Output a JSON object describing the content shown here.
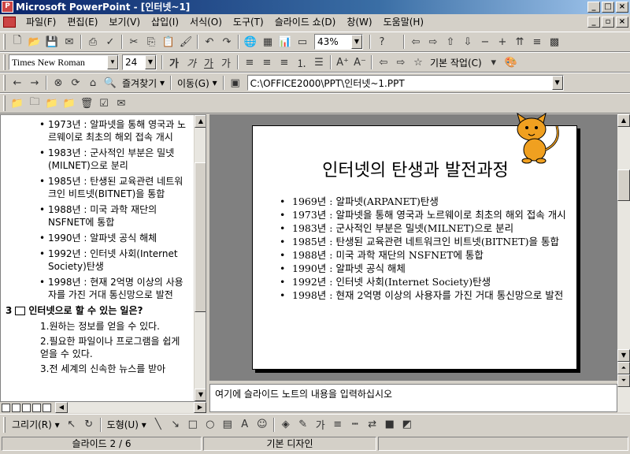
{
  "window": {
    "title": "Microsoft PowerPoint - [인터넷~1]"
  },
  "menu": [
    "파일(F)",
    "편집(E)",
    "보기(V)",
    "삽입(I)",
    "서식(O)",
    "도구(T)",
    "슬라이드 쇼(D)",
    "창(W)",
    "도움말(H)"
  ],
  "standard_toolbar": {
    "zoom": "43%"
  },
  "formatting_toolbar": {
    "font": "Times New Roman",
    "size": "24",
    "design_label": "기본 작업(C)",
    "format_glyphs": [
      "가",
      "가",
      "가",
      "가"
    ]
  },
  "web_toolbar": {
    "favorites": "즐겨찾기",
    "go": "이동(G)",
    "address": "C:\\OFFICE2000\\PPT\\인터넷~1.PPT"
  },
  "outline": {
    "bullets": [
      "1973년 : 알파넷을 통해 영국과 노르웨이로 최초의 해외 접속 개시",
      "1983년 : 군사적인 부분은 밀넷(MILNET)으로 분리",
      "1985년 : 탄생된 교육관련 네트워크인 비트넷(BITNET)을 통합",
      "1988년 : 미국 과학 재단의 NSFNET에 통합",
      "1990년 : 알파넷 공식 해체",
      "1992년 : 인터넷 사회(Internet Society)탄생",
      "1998년 : 현재 2억명 이상의 사용자를 가진 거대 통신망으로 발전"
    ],
    "slide3": {
      "num": "3",
      "title": "인터넷으로 할 수 있는 일은?"
    },
    "slide3_items": [
      "1.원하는 정보를 얻을 수 있다.",
      "2.필요한 파일이나 프로그램을 쉽게 얻을 수 있다.",
      "3.전 세계의 신속한 뉴스를 받아"
    ]
  },
  "slide": {
    "title": "인터넷의 탄생과 발전과정",
    "bullets": [
      "1969년 : 알파넷(ARPANET)탄생",
      "1973년 : 알파넷을 통해 영국과 노르웨이로 최초의 해외 접속 개시",
      "1983년 : 군사적인 부분은 밀넷(MILNET)으로 분리",
      "1985년 : 탄생된 교육관련 네트워크인 비트넷(BITNET)을 통합",
      "1988년 : 미국 과학 재단의 NSFNET에 통합",
      "1990년 : 알파넷 공식 해체",
      "1992년 : 인터넷 사회(Internet Society)탄생",
      "1998년 : 현재 2억명 이상의 사용자를 가진 거대 통신망으로 발전"
    ]
  },
  "notes": {
    "placeholder": "여기에 슬라이드 노트의 내용을 입력하십시오"
  },
  "drawing_toolbar": {
    "draw": "그리기(R)",
    "autoshapes": "도형(U)"
  },
  "status": {
    "slide": "슬라이드 2 / 6",
    "design": "기본 디자인"
  }
}
